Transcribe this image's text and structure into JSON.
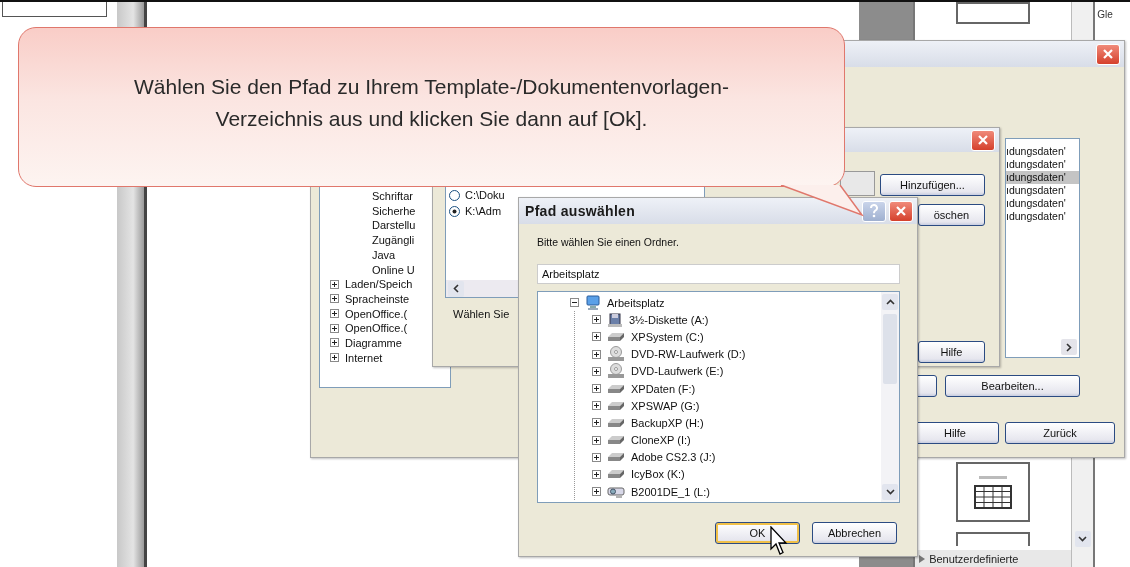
{
  "callout": {
    "lines": [
      "Wählen Sie den Pfad zu Ihrem Template-/Dokumentenvorlagen-",
      "Verzeichnis aus und klicken Sie dann auf [Ok]."
    ]
  },
  "side_panel": {
    "corner_text": "Gle",
    "footer_label": "Benutzerdefinierte"
  },
  "options_dialog": {
    "tree": [
      {
        "label": "Schriftar",
        "kind": "child"
      },
      {
        "label": "Sicherhe",
        "kind": "child"
      },
      {
        "label": "Darstellu",
        "kind": "child"
      },
      {
        "label": "Zugängli",
        "kind": "child"
      },
      {
        "label": "Java",
        "kind": "child"
      },
      {
        "label": "Online U",
        "kind": "child"
      },
      {
        "label": "Laden/Speich",
        "kind": "folder",
        "expanded": false
      },
      {
        "label": "Spracheinste",
        "kind": "folder",
        "expanded": false
      },
      {
        "label": "OpenOffice.(",
        "kind": "folder",
        "expanded": false
      },
      {
        "label": "OpenOffice.(",
        "kind": "folder",
        "expanded": false
      },
      {
        "label": "Diagramme",
        "kind": "folder",
        "expanded": false
      },
      {
        "label": "Internet",
        "kind": "folder",
        "expanded": false
      }
    ],
    "list": [
      {
        "text": "ıdungsdaten'",
        "selected": false
      },
      {
        "text": "ıdungsdaten'",
        "selected": false
      },
      {
        "text": "ıdungsdaten'",
        "selected": true
      },
      {
        "text": "ıdungsdaten'",
        "selected": false
      },
      {
        "text": "ıdungsdaten'",
        "selected": false
      },
      {
        "text": "ıdungsdaten'",
        "selected": false
      }
    ],
    "edit_button": "Bearbeiten...",
    "buttons": [
      "Hilfe",
      "Zurück"
    ]
  },
  "paths_dialog": {
    "paths": [
      {
        "text": "C:\\Doku",
        "selected": false
      },
      {
        "text": "K:\\Adm",
        "selected": true
      }
    ],
    "hint": "Wählen Sie",
    "add_button": "Hinzufügen...",
    "delete_button": "öschen",
    "help_button": "Hilfe"
  },
  "folder_dialog": {
    "title": "Pfad auswählen",
    "prompt": "Bitte wählen Sie einen Ordner.",
    "folder_field": "Arbeitsplatz",
    "tree": [
      {
        "label": "Arbeitsplatz",
        "kind": "computer",
        "expanded": true,
        "children": [
          {
            "label": "3½-Diskette (A:)",
            "kind": "floppy",
            "expanded": false
          },
          {
            "label": "XPSystem (C:)",
            "kind": "drive",
            "expanded": false
          },
          {
            "label": "DVD-RW-Laufwerk (D:)",
            "kind": "disc",
            "expanded": false
          },
          {
            "label": "DVD-Laufwerk (E:)",
            "kind": "disc",
            "expanded": false
          },
          {
            "label": "XPDaten (F:)",
            "kind": "drive",
            "expanded": false
          },
          {
            "label": "XPSWAP (G:)",
            "kind": "drive",
            "expanded": false
          },
          {
            "label": "BackupXP (H:)",
            "kind": "drive",
            "expanded": false
          },
          {
            "label": "CloneXP (I:)",
            "kind": "drive",
            "expanded": false
          },
          {
            "label": "Adobe CS2.3 (J:)",
            "kind": "drive",
            "expanded": false
          },
          {
            "label": "IcyBox (K:)",
            "kind": "drive",
            "expanded": false
          },
          {
            "label": "B2001DE_1 (L:)",
            "kind": "network",
            "expanded": false
          }
        ]
      }
    ],
    "buttons": [
      {
        "label": "OK",
        "kind": "default"
      },
      {
        "label": "Abbrechen",
        "kind": "normal"
      }
    ]
  }
}
